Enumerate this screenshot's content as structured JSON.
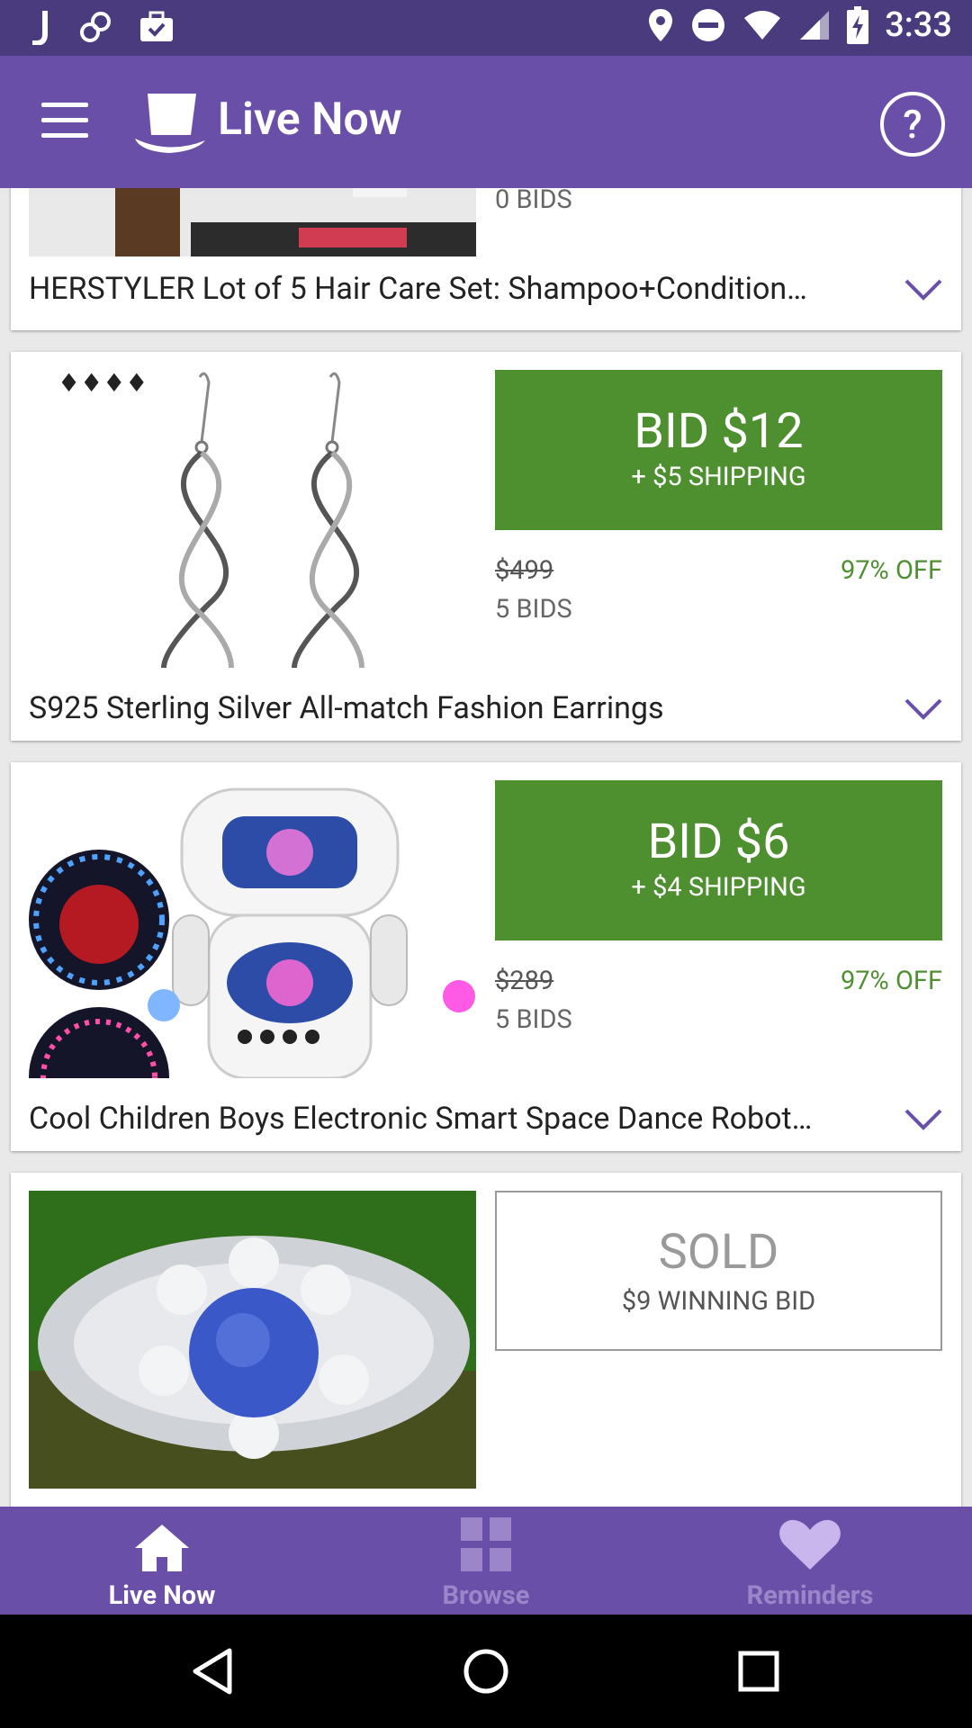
{
  "status_bar": {
    "time": "3:33"
  },
  "app_bar": {
    "title": "Live Now",
    "help_glyph": "?"
  },
  "listings": [
    {
      "title": "HERSTYLER Lot of 5 Hair Care Set: Shampoo+Condition…",
      "bids": "0 BIDS"
    },
    {
      "title": "S925  Sterling Silver All-match Fashion Earrings",
      "bid_label": "BID $12",
      "shipping": "+ $5 SHIPPING",
      "original_price": "$499",
      "bids": "5 BIDS",
      "discount": "97% OFF"
    },
    {
      "title": "Cool Children Boys Electronic Smart Space Dance Robot…",
      "bid_label": "BID $6",
      "shipping": "+ $4 SHIPPING",
      "original_price": "$289",
      "bids": "5 BIDS",
      "discount": "97% OFF"
    },
    {
      "sold_label": "SOLD",
      "winning_bid": "$9 WINNING BID"
    }
  ],
  "bottom_nav": [
    {
      "label": "Live Now",
      "icon": "home-icon",
      "active": true
    },
    {
      "label": "Browse",
      "icon": "grid-icon",
      "active": false
    },
    {
      "label": "Reminders",
      "icon": "heart-icon",
      "active": false
    }
  ],
  "colors": {
    "status_bar": "#4a3a7e",
    "primary": "#6a4fa8",
    "bid_green": "#4e8f30"
  }
}
